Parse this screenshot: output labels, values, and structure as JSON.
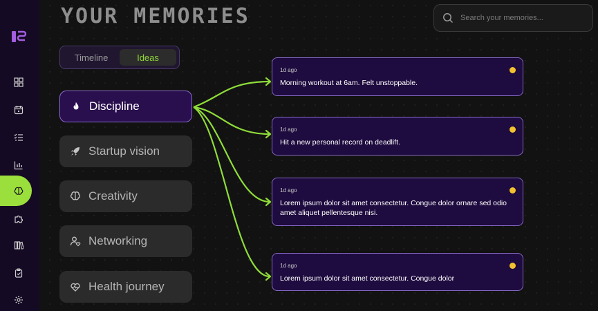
{
  "app": {
    "logo_icon": "brain-logo",
    "title": "YOUR MEMORIES"
  },
  "search": {
    "placeholder": "Search your memories...",
    "value": ""
  },
  "view_toggle": {
    "options": [
      {
        "label": "Timeline",
        "active": false
      },
      {
        "label": "Ideas",
        "active": true
      }
    ]
  },
  "sidebar": {
    "items": [
      {
        "icon": "dashboard-icon",
        "active": false
      },
      {
        "icon": "calendar-icon",
        "active": false
      },
      {
        "icon": "checklist-icon",
        "active": false
      },
      {
        "icon": "bar-chart-icon",
        "active": false
      },
      {
        "icon": "brain-icon",
        "active": true
      },
      {
        "icon": "puzzle-icon",
        "active": false
      },
      {
        "icon": "library-icon",
        "active": false
      },
      {
        "icon": "clipboard-icon",
        "active": false
      },
      {
        "icon": "settings-icon",
        "active": false
      }
    ]
  },
  "categories": [
    {
      "label": "Discipline",
      "icon": "flame-icon",
      "active": true
    },
    {
      "label": "Startup vision",
      "icon": "rocket-icon",
      "active": false
    },
    {
      "label": "Creativity",
      "icon": "brain-icon",
      "active": false
    },
    {
      "label": "Networking",
      "icon": "user-heart-icon",
      "active": false
    },
    {
      "label": "Health journey",
      "icon": "heart-pulse-icon",
      "active": false
    }
  ],
  "memories": [
    {
      "time": "1d ago",
      "text": "Morning workout at 6am. Felt unstoppable."
    },
    {
      "time": "1d ago",
      "text": "Hit a new personal record on deadlift."
    },
    {
      "time": "1d ago",
      "text": "Lorem ipsum dolor sit amet consectetur. Congue dolor ornare sed odio amet aliquet pellentesque nisi."
    },
    {
      "time": "1d ago",
      "text": "Lorem ipsum dolor sit amet consectetur. Congue dolor"
    }
  ],
  "colors": {
    "accent_green": "#9bdf3c",
    "card_purple": "#1e0b3f",
    "card_border": "#8668c4",
    "status_dot": "#f2c12e",
    "sidebar_bg": "#150a24"
  }
}
